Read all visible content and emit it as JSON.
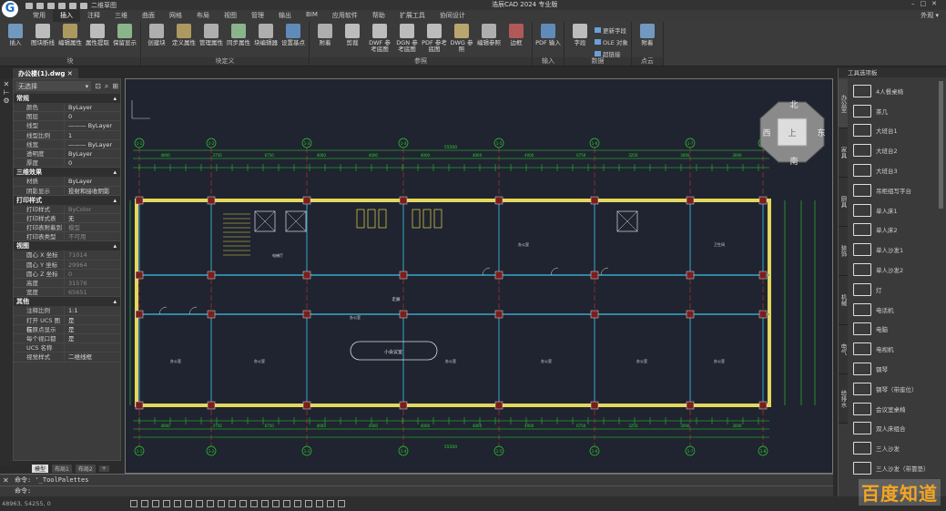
{
  "app": {
    "title": "浩辰CAD 2024 专业版",
    "workspace": "二维草图",
    "appearance": "外观"
  },
  "menu": [
    "常用",
    "插入",
    "注释",
    "三维",
    "曲面",
    "网格",
    "布局",
    "视图",
    "管理",
    "输出",
    "BIM",
    "应用软件",
    "帮助",
    "扩展工具",
    "协同设计"
  ],
  "menu_active": 1,
  "ribbon": [
    {
      "label": "块",
      "buttons": [
        "插入",
        "图块断线",
        "编辑属性",
        "属性提取",
        "保留显示"
      ]
    },
    {
      "label": "块定义",
      "buttons": [
        "创建块",
        "定义属性",
        "管理属性",
        "同步属性",
        "块编辑器",
        "设置基点"
      ]
    },
    {
      "label": "参照",
      "buttons": [
        "附着",
        "剪裁",
        "DWF 参考底图",
        "DGN 参考底图",
        "PDF 参考底图",
        "DWG 参照",
        "编辑参照",
        "边框"
      ]
    },
    {
      "label": "输入",
      "buttons": [
        "PDF 输入"
      ]
    },
    {
      "label": "数据",
      "buttons": [
        "字段"
      ],
      "small": [
        "更新字段",
        "OLE 对象",
        "超链接"
      ]
    },
    {
      "label": "点云",
      "buttons": [
        "附着"
      ]
    }
  ],
  "document_tab": "办公楼(1).dwg",
  "properties": {
    "selection": "无选择",
    "sections": [
      {
        "title": "常规",
        "rows": [
          [
            "颜色",
            "ByLayer"
          ],
          [
            "图层",
            "0"
          ],
          [
            "线型",
            "——— ByLayer"
          ],
          [
            "线型比例",
            "1"
          ],
          [
            "线宽",
            "——— ByLayer"
          ],
          [
            "透明度",
            "ByLayer"
          ],
          [
            "厚度",
            "0"
          ]
        ]
      },
      {
        "title": "三维效果",
        "rows": [
          [
            "材质",
            "ByLayer"
          ],
          [
            "阴影显示",
            "投射和接收阴影"
          ]
        ]
      },
      {
        "title": "打印样式",
        "rows": [
          [
            "打印样式",
            "ByColor"
          ],
          [
            "打印样式表",
            "无"
          ],
          [
            "打印表附着到",
            "模型"
          ],
          [
            "打印表类型",
            "不可用"
          ]
        ]
      },
      {
        "title": "视图",
        "rows": [
          [
            "圆心 X 坐标",
            "71014"
          ],
          [
            "圆心 Y 坐标",
            "29964"
          ],
          [
            "圆心 Z 坐标",
            "0"
          ],
          [
            "高度",
            "31576"
          ],
          [
            "宽度",
            "65651"
          ]
        ]
      },
      {
        "title": "其他",
        "rows": [
          [
            "注释比例",
            "1:1"
          ],
          [
            "打开 UCS 图标",
            "是"
          ],
          [
            "在原点显示",
            "是"
          ],
          [
            "每个视口都",
            "是"
          ],
          [
            "UCS 名称",
            ""
          ],
          [
            "视觉样式",
            "二维线框"
          ]
        ]
      }
    ]
  },
  "layout_tabs": [
    "模型",
    "布局1",
    "布局2",
    "+"
  ],
  "command": {
    "lines": [
      "命令: '_ToolPalettes",
      "命令:"
    ]
  },
  "status": {
    "coords": "48963, 54255, 0"
  },
  "viewcube": {
    "north": "北",
    "south": "南",
    "east": "东",
    "west": "西",
    "top": "上"
  },
  "drawing": {
    "axes_top": [
      "1-1",
      "1-2",
      "1-3",
      "1-4",
      "1-5",
      "1-6",
      "1-7",
      "1-8"
    ],
    "total_dim": "55500",
    "dims": [
      "4000",
      "3750",
      "6750",
      "4000",
      "4000",
      "4000",
      "4000",
      "4000",
      "6750",
      "3250",
      "3000",
      "3000"
    ],
    "rooms": {
      "corridor": "走廊",
      "meeting": "小会议室",
      "office": "办公室",
      "elevator": "电梯厅",
      "toilet": "卫生间"
    },
    "colors": {
      "wall": "#e8d84a",
      "dim": "#2fd12f",
      "axis": "#c83232",
      "partition": "#3aa6c8",
      "bg": "#1f2430"
    }
  },
  "palette": {
    "title": "工具选项板",
    "tabs": [
      "办公室",
      "家具",
      "厨具",
      "装饰",
      "机械",
      "电气",
      "给排水"
    ],
    "items": [
      "4人餐桌椅",
      "茶几",
      "大班台1",
      "大班台2",
      "大班台3",
      "吊柜组写字台",
      "单人床1",
      "单人床2",
      "单人沙发1",
      "单人沙发2",
      "灯",
      "电话机",
      "电脑",
      "电视机",
      "钢琴",
      "钢琴（带座位）",
      "会议室桌椅",
      "双人床组合",
      "三人沙发",
      "三人沙发（带靠垫）"
    ]
  },
  "watermark": "百度知道"
}
